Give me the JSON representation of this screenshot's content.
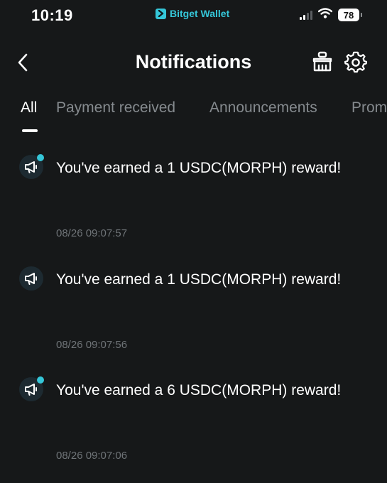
{
  "status_bar": {
    "time": "10:19",
    "app_name": "Bitget Wallet",
    "battery": "78"
  },
  "header": {
    "title": "Notifications"
  },
  "tabs": [
    {
      "label": "All",
      "active": true
    },
    {
      "label": "Payment received",
      "active": false
    },
    {
      "label": "Announcements",
      "active": false
    },
    {
      "label": "Prom",
      "active": false
    }
  ],
  "notifications": [
    {
      "title": "You've earned a 1 USDC(MORPH) reward!",
      "time": "08/26 09:07:57",
      "unread": true,
      "icon": "megaphone-icon"
    },
    {
      "title": "You've earned a 1 USDC(MORPH) reward!",
      "time": "08/26 09:07:56",
      "unread": false,
      "icon": "megaphone-icon"
    },
    {
      "title": "You've earned a 6 USDC(MORPH) reward!",
      "time": "08/26 09:07:06",
      "unread": true,
      "icon": "megaphone-icon"
    }
  ],
  "colors": {
    "background": "#161819",
    "accent": "#35c6d8",
    "muted_text": "#858a8e",
    "time_text": "#6f7478"
  }
}
